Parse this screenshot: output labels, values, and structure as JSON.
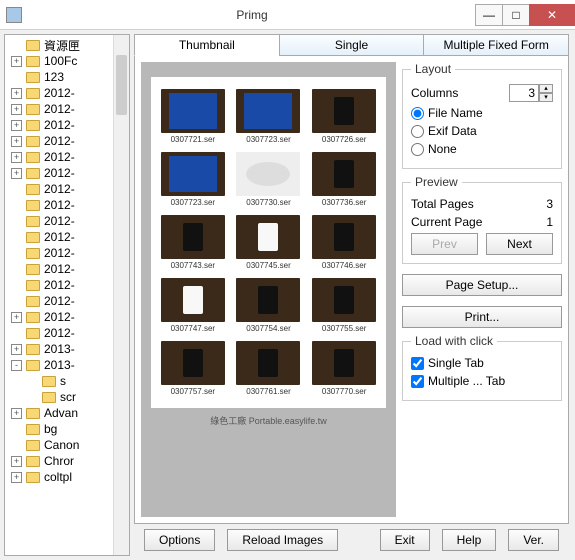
{
  "window": {
    "title": "Primg"
  },
  "tree": {
    "items": [
      {
        "exp": "",
        "indent": 0,
        "label": "資源匣"
      },
      {
        "exp": "+",
        "indent": 0,
        "label": "100Fc"
      },
      {
        "exp": "",
        "indent": 0,
        "label": "123"
      },
      {
        "exp": "+",
        "indent": 0,
        "label": "2012-"
      },
      {
        "exp": "+",
        "indent": 0,
        "label": "2012-"
      },
      {
        "exp": "+",
        "indent": 0,
        "label": "2012-"
      },
      {
        "exp": "+",
        "indent": 0,
        "label": "2012-"
      },
      {
        "exp": "+",
        "indent": 0,
        "label": "2012-"
      },
      {
        "exp": "+",
        "indent": 0,
        "label": "2012-"
      },
      {
        "exp": "",
        "indent": 0,
        "label": "2012-"
      },
      {
        "exp": "",
        "indent": 0,
        "label": "2012-"
      },
      {
        "exp": "",
        "indent": 0,
        "label": "2012-"
      },
      {
        "exp": "",
        "indent": 0,
        "label": "2012-"
      },
      {
        "exp": "",
        "indent": 0,
        "label": "2012-"
      },
      {
        "exp": "",
        "indent": 0,
        "label": "2012-"
      },
      {
        "exp": "",
        "indent": 0,
        "label": "2012-"
      },
      {
        "exp": "",
        "indent": 0,
        "label": "2012-"
      },
      {
        "exp": "+",
        "indent": 0,
        "label": "2012-"
      },
      {
        "exp": "",
        "indent": 0,
        "label": "2012-"
      },
      {
        "exp": "+",
        "indent": 0,
        "label": "2013-"
      },
      {
        "exp": "-",
        "indent": 0,
        "label": "2013-"
      },
      {
        "exp": "",
        "indent": 1,
        "label": "s"
      },
      {
        "exp": "",
        "indent": 1,
        "label": "scr"
      },
      {
        "exp": "+",
        "indent": 0,
        "label": "Advan"
      },
      {
        "exp": "",
        "indent": 0,
        "label": "bg"
      },
      {
        "exp": "",
        "indent": 0,
        "label": "Canon"
      },
      {
        "exp": "+",
        "indent": 0,
        "label": "Chror"
      },
      {
        "exp": "+",
        "indent": 0,
        "label": "coltpl"
      }
    ]
  },
  "tabs": {
    "thumbnail": "Thumbnail",
    "single": "Single",
    "multiple": "Multiple Fixed Form"
  },
  "thumbnails": [
    {
      "style": "box",
      "cap": "0307721.ser"
    },
    {
      "style": "box",
      "cap": "0307723.ser"
    },
    {
      "style": "phone",
      "cap": "0307726.ser"
    },
    {
      "style": "box",
      "cap": "0307723.ser"
    },
    {
      "style": "ear",
      "cap": "0307730.ser"
    },
    {
      "style": "phone",
      "cap": "0307736.ser"
    },
    {
      "style": "phone",
      "cap": "0307743.ser"
    },
    {
      "style": "phonew",
      "cap": "0307745.ser"
    },
    {
      "style": "phone",
      "cap": "0307746.ser"
    },
    {
      "style": "phonew",
      "cap": "0307747.ser"
    },
    {
      "style": "phone",
      "cap": "0307754.ser"
    },
    {
      "style": "phone",
      "cap": "0307755.ser"
    },
    {
      "style": "phone",
      "cap": "0307757.ser"
    },
    {
      "style": "phone",
      "cap": "0307761.ser"
    },
    {
      "style": "phone",
      "cap": "0307770.ser"
    }
  ],
  "watermark": "綠色工廠 Portable.easylife.tw",
  "layout": {
    "legend": "Layout",
    "columns_label": "Columns",
    "columns_value": "3",
    "radio_filename": "File Name",
    "radio_exif": "Exif Data",
    "radio_none": "None"
  },
  "preview": {
    "legend": "Preview",
    "total_label": "Total Pages",
    "total_value": "3",
    "current_label": "Current Page",
    "current_value": "1",
    "prev": "Prev",
    "next": "Next"
  },
  "buttons": {
    "page_setup": "Page Setup...",
    "print": "Print..."
  },
  "load": {
    "legend": "Load with click",
    "single": "Single Tab",
    "multiple": "Multiple ... Tab"
  },
  "bottom": {
    "options": "Options",
    "reload": "Reload Images",
    "exit": "Exit",
    "help": "Help",
    "ver": "Ver."
  }
}
